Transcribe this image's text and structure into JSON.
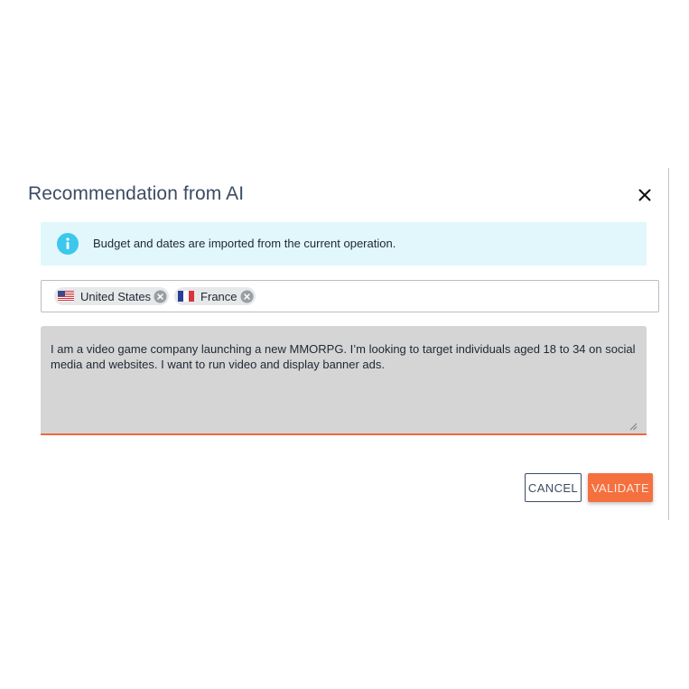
{
  "dialog": {
    "title": "Recommendation from AI",
    "close_icon": "close-icon"
  },
  "info_banner": {
    "icon": "info-icon",
    "text": "Budget and dates are imported from the current operation.",
    "background": "#e1f7fc",
    "icon_color": "#3cc7ec"
  },
  "countries": {
    "chips": [
      {
        "label": "United States",
        "flag": "us-flag-icon"
      },
      {
        "label": "France",
        "flag": "fr-flag-icon"
      }
    ]
  },
  "prompt": {
    "value": "I am a video game company launching a new MMORPG. I’m looking to target individuals aged 18 to 34 on social media and websites. I want to run video and display banner ads."
  },
  "actions": {
    "cancel_label": "CANCEL",
    "validate_label": "VALIDATE"
  },
  "colors": {
    "accent": "#f4703f",
    "title": "#3d4b63",
    "textarea_bg": "#d5d5d5"
  }
}
